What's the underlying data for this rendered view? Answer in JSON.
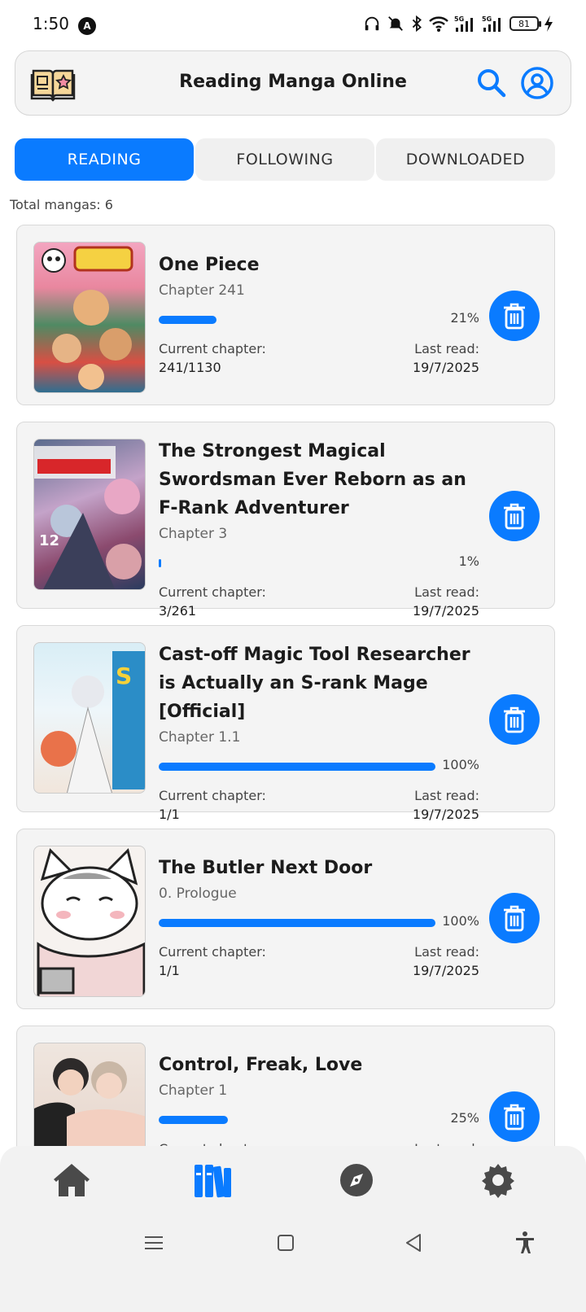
{
  "status_bar": {
    "time": "1:50",
    "notif_letter": "A",
    "battery": "81"
  },
  "header": {
    "title": "Reading Manga Online"
  },
  "tabs": [
    {
      "label": "READING",
      "active": true
    },
    {
      "label": "FOLLOWING",
      "active": false
    },
    {
      "label": "DOWNLOADED",
      "active": false
    }
  ],
  "total_label": "Total mangas: 6",
  "labels": {
    "current_chapter": "Current chapter:",
    "last_read": "Last read:"
  },
  "mangas": [
    {
      "title": "One Piece",
      "chapter": "Chapter 241",
      "progress_pct": "21%",
      "progress": 0.21,
      "current": "241/1130",
      "last_read": "19/7/2025"
    },
    {
      "title": "The Strongest Magical Swordsman Ever Reborn as an F-Rank Adventurer",
      "chapter": "Chapter 3",
      "progress_pct": "1%",
      "progress": 0.01,
      "current": "3/261",
      "last_read": "19/7/2025"
    },
    {
      "title": "Cast-off Magic Tool Researcher is Actually an S-rank Mage [Official]",
      "chapter": "Chapter 1.1",
      "progress_pct": "100%",
      "progress": 1.0,
      "current": "1/1",
      "last_read": "19/7/2025"
    },
    {
      "title": "The Butler Next Door",
      "chapter": "0. Prologue",
      "progress_pct": "100%",
      "progress": 1.0,
      "current": "1/1",
      "last_read": "19/7/2025"
    },
    {
      "title": "Control, Freak, Love",
      "chapter": "Chapter 1",
      "progress_pct": "25%",
      "progress": 0.25,
      "current": "",
      "last_read": ""
    }
  ],
  "colors": {
    "accent": "#0a7bff"
  },
  "bottom_nav": [
    "home-icon",
    "library-icon",
    "explore-icon",
    "settings-icon"
  ]
}
